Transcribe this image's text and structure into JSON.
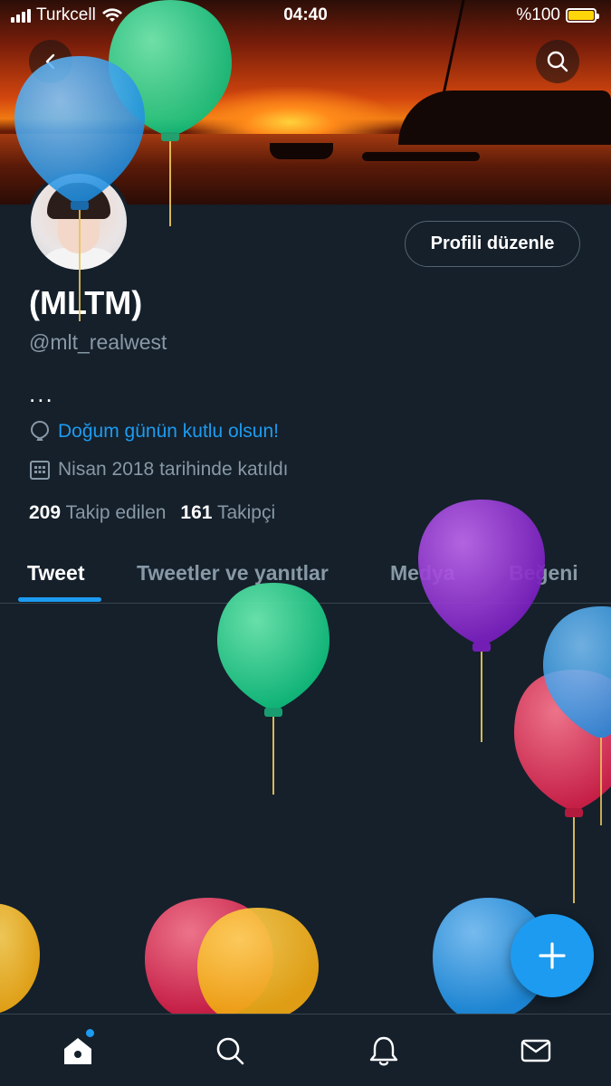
{
  "status_bar": {
    "carrier": "Turkcell",
    "time": "04:40",
    "battery": "%100",
    "battery_level": 1.0
  },
  "profile": {
    "edit_button": "Profili düzenle",
    "name": "(MLTM)",
    "handle": "@mlt_realwest",
    "bio": "...",
    "birthday_text": "Doğum günün kutlu olsun!",
    "joined_text": "Nisan 2018 tarihinde katıldı",
    "following_count": "209",
    "following_label": "Takip edilen",
    "followers_count": "161",
    "followers_label": "Takipçi"
  },
  "tabs": [
    {
      "label": "Tweet",
      "active": true
    },
    {
      "label": "Tweetler ve yanıtlar",
      "active": false
    },
    {
      "label": "Medya",
      "active": false
    },
    {
      "label": "Beğeni",
      "active": false
    }
  ],
  "icons": {
    "back": "back-arrow-icon",
    "search": "search-icon",
    "balloon": "balloon-icon",
    "calendar": "calendar-icon",
    "compose": "plus-icon",
    "home": "home-icon",
    "explore": "search-icon",
    "notifications": "bell-icon",
    "messages": "mail-icon"
  },
  "colors": {
    "background": "#15202b",
    "accent": "#1d9bf0",
    "muted": "#8899a6"
  }
}
